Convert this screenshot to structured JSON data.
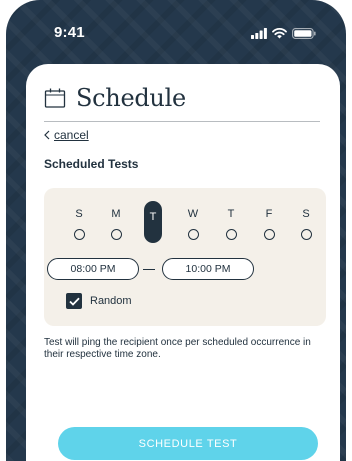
{
  "status_bar": {
    "time": "9:41"
  },
  "header": {
    "title": "Schedule",
    "cancel_label": "cancel"
  },
  "section": {
    "title": "Scheduled Tests"
  },
  "days": [
    {
      "letter": "S",
      "selected": false
    },
    {
      "letter": "M",
      "selected": false
    },
    {
      "letter": "T",
      "selected": true
    },
    {
      "letter": "W",
      "selected": false
    },
    {
      "letter": "T",
      "selected": false
    },
    {
      "letter": "F",
      "selected": false
    },
    {
      "letter": "S",
      "selected": false
    }
  ],
  "time_range": {
    "start": "08:00 PM",
    "end": "10:00 PM"
  },
  "random": {
    "label": "Random",
    "checked": true
  },
  "helper_text": "Test will ping the recipient once per scheduled occurrence in their respective time zone.",
  "primary_button": {
    "label": "SCHEDULE TEST"
  },
  "colors": {
    "background": "#24384c",
    "text": "#22323f",
    "panel": "#f4f0e9",
    "button": "#5fd3ea"
  }
}
